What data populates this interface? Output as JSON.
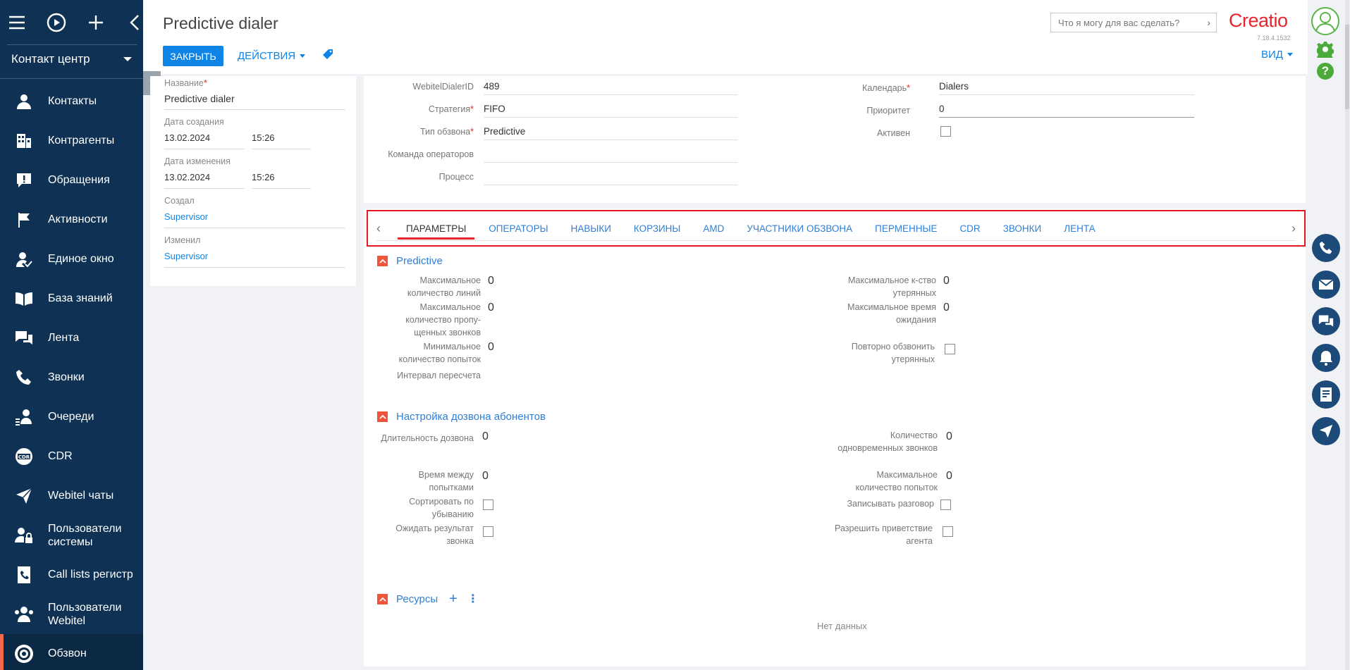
{
  "workspace": "Контакт центр",
  "nav": [
    {
      "label": "Контакты",
      "icon": "person-icon"
    },
    {
      "label": "Контрагенты",
      "icon": "building-icon"
    },
    {
      "label": "Обращения",
      "icon": "alert-icon"
    },
    {
      "label": "Активности",
      "icon": "flag-icon"
    },
    {
      "label": "Единое окно",
      "icon": "person-check-icon"
    },
    {
      "label": "База знаний",
      "icon": "book-icon"
    },
    {
      "label": "Лента",
      "icon": "chat-icon"
    },
    {
      "label": "Звонки",
      "icon": "phone-icon"
    },
    {
      "label": "Очереди",
      "icon": "queue-icon"
    },
    {
      "label": "CDR",
      "icon": "cdr-icon"
    },
    {
      "label": "Webitel чаты",
      "icon": "send-icon"
    },
    {
      "label": "Пользователи системы",
      "icon": "user-lock-icon"
    },
    {
      "label": "Call lists регистр",
      "icon": "phone-list-icon"
    },
    {
      "label": "Пользователи Webitel",
      "icon": "users-icon"
    },
    {
      "label": "Обзвон",
      "icon": "dialer-icon"
    }
  ],
  "header": {
    "title": "Predictive dialer",
    "close_label": "ЗАКРЫТЬ",
    "actions_label": "ДЕЙСТВИЯ",
    "search_placeholder": "Что я могу для вас сделать?",
    "logo": "Creatio",
    "version": "7.18.4.1532",
    "view_label": "ВИД"
  },
  "info": {
    "name_label": "Название",
    "name_value": "Predictive dialer",
    "created_label": "Дата создания",
    "created_date": "13.02.2024",
    "created_time": "15:26",
    "modified_label": "Дата изменения",
    "modified_date": "13.02.2024",
    "modified_time": "15:26",
    "created_by_label": "Создал",
    "created_by_value": "Supervisor",
    "modified_by_label": "Изменил",
    "modified_by_value": "Supervisor"
  },
  "main": {
    "webitel_id_label": "WebitelDialerID",
    "webitel_id_value": "489",
    "strategy_label": "Стратегия",
    "strategy_value": "FIFO",
    "type_label": "Тип обзвона",
    "type_value": "Predictive",
    "team_label": "Команда операторов",
    "team_value": "",
    "process_label": "Процесс",
    "process_value": "",
    "calendar_label": "Календарь",
    "calendar_value": "Dialers",
    "priority_label": "Приоритет",
    "priority_value": "0",
    "active_label": "Активен"
  },
  "tabs": [
    "ПАРАМЕТРЫ",
    "ОПЕРАТОРЫ",
    "НАВЫКИ",
    "КОРЗИНЫ",
    "AMD",
    "УЧАСТНИКИ ОБЗВОНА",
    "ПЕРМЕННЫЕ",
    "CDR",
    "ЗВОНКИ",
    "ЛЕНТА"
  ],
  "predictive": {
    "title": "Predictive",
    "max_lines_label": "Максимальное количество линий",
    "max_lines_value": "0",
    "max_missed_label": "Максимальное количество пропу-щенных звонков",
    "max_missed_value": "0",
    "min_attempts_label": "Минимальное количество попыток",
    "min_attempts_value": "0",
    "recalc_label": "Интервал пересчета",
    "recalc_value": "",
    "max_lost_label": "Максимальное к-ство утерянных",
    "max_lost_value": "0",
    "max_wait_label": "Максимальное время ожидания",
    "max_wait_value": "0",
    "recall_lost_label": "Повторно обзвонить утерянных"
  },
  "dial_setup": {
    "title": "Настройка дозвона абонентов",
    "duration_label": "Длительность дозвона",
    "duration_value": "0",
    "between_label": "Время между попытками",
    "between_value": "0",
    "sort_desc_label": "Сортировать по убыванию",
    "wait_result_label": "Ожидать результат звонка",
    "concurrent_label": "Количество одновременных звонков",
    "concurrent_value": "0",
    "max_attempts_label": "Максимальное количество попыток",
    "max_attempts_value": "0",
    "record_label": "Записывать разговор",
    "agent_greeting_label": "Разрешить приветствие агента"
  },
  "resources": {
    "title": "Ресурсы",
    "empty": "Нет данных"
  }
}
